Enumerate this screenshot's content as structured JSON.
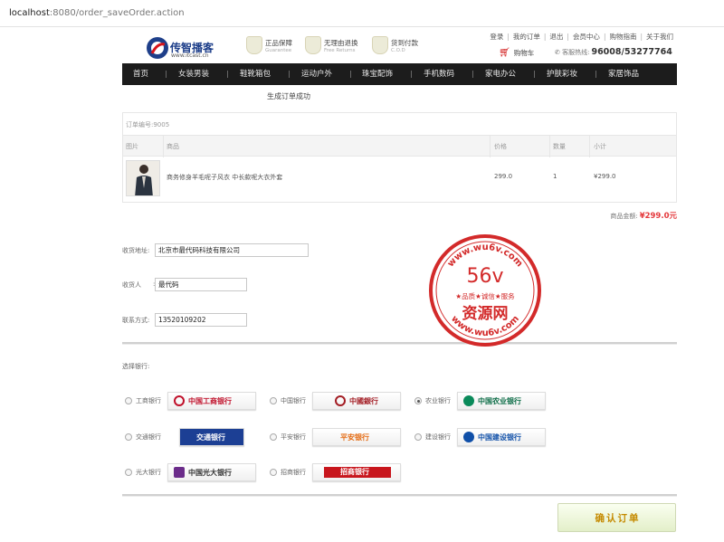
{
  "browser": {
    "url_host": "localhost",
    "url_rest": ":8080/order_saveOrder.action"
  },
  "header": {
    "logo_name": "传智播客",
    "logo_site": "www.itcast.cn",
    "promos": [
      {
        "title": "正品保障",
        "subtitle": "Guarantee"
      },
      {
        "title": "无理由退换",
        "subtitle": "Free Returns"
      },
      {
        "title": "货到付款",
        "subtitle": "C.O.D"
      }
    ],
    "top_links": [
      "登录",
      "我的订单",
      "退出",
      "会员中心",
      "购物指南",
      "关于我们"
    ],
    "cart_label": "购物车",
    "hotline_label": "客服热线:",
    "hotline_number": "96008/53277764"
  },
  "nav": [
    "首页",
    "女装男装",
    "鞋靴箱包",
    "运动户外",
    "珠宝配饰",
    "手机数码",
    "家电办公",
    "护肤彩妆",
    "家居饰品"
  ],
  "order": {
    "success_msg": "生成订单成功",
    "order_no": "订单编号:9005",
    "columns": [
      "图片",
      "商品",
      "价格",
      "数量",
      "小计"
    ],
    "items": [
      {
        "name": "商务修身羊毛呢子风衣 中长款呢大衣外套",
        "price": "299.0",
        "qty": "1",
        "subtotal": "¥299.0"
      }
    ],
    "total_label": "商品金额:",
    "total_value": "¥299.0元"
  },
  "form": {
    "address_label": "收货地址:",
    "address_value": "北京市最代码科技有限公司",
    "receiver_label": "收货人",
    "receiver_value": "最代码",
    "phone_label": "联系方式:",
    "phone_value": "13520109202"
  },
  "banks": {
    "title": "选择银行:",
    "list": [
      {
        "name": "工商银行",
        "logo": "中国工商银行",
        "color": "#c0102a",
        "selected": false
      },
      {
        "name": "中国银行",
        "logo": "中國銀行",
        "color": "#a31d24",
        "selected": false
      },
      {
        "name": "农业银行",
        "logo": "中国农业银行",
        "color": "#0a8a5a",
        "selected": true
      },
      {
        "name": "交通银行",
        "logo": "交通银行",
        "color": "#1c3f94",
        "selected": false
      },
      {
        "name": "平安银行",
        "logo": "平安银行",
        "color": "#e46a12",
        "selected": false
      },
      {
        "name": "建设银行",
        "logo": "中国建设银行",
        "color": "#0f4fa8",
        "selected": false
      },
      {
        "name": "光大银行",
        "logo": "中国光大银行",
        "color": "#6b2c8a",
        "selected": false
      },
      {
        "name": "招商银行",
        "logo": "招商银行",
        "color": "#c8161d",
        "selected": false
      }
    ]
  },
  "confirm_label": "确认订单",
  "watermark": {
    "big": "56v",
    "mid": "资源网",
    "url": "www.wu6v.com",
    "slogan": "★品质★诚信★服务"
  },
  "colors": {
    "nav_bg": "#1c1c1c",
    "price_red": "#e4393c",
    "confirm_text": "#c58a00"
  }
}
